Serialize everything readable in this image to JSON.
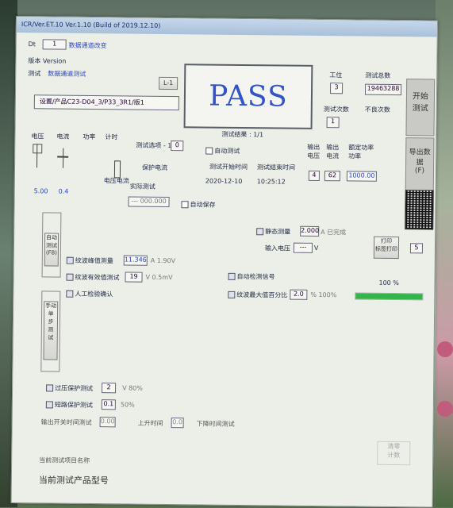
{
  "window": {
    "title": "ICR/Ver.ET.10 Ver.1.10 (Build of 2019.12.10)"
  },
  "left_panel": {
    "product_label": "Dt",
    "product_value": "1",
    "product_link": "数据通道改变",
    "device_label": "版本 Version",
    "pcs_label": "测试",
    "pcs_link": "数据通道测试",
    "side_btn": "L-1",
    "name_box": "设置/产品C23-D04_3/P33_3R1/版1"
  },
  "result": {
    "status": "PASS",
    "caption": "测试结果 : 1/1"
  },
  "right_top": {
    "station_label": "工位",
    "station_value": "3",
    "pass_label": "测试次数",
    "pass_value": "1",
    "total_label": "测试总数",
    "total_value": "19463288",
    "fail_label": "不良次数",
    "fail_value": "1",
    "start_btn": "开始\n测试",
    "export_btn": "导出数据\n(F)"
  },
  "middle_block": {
    "c1": "电压",
    "c2": "电流",
    "c3": "功率",
    "c4": "计时",
    "set_label": "测试选项 - 1",
    "set_value": "0",
    "limit_label": "保护电流",
    "result_label": "实际测试",
    "result_value": "--- 000.000",
    "voltage_unit": "电压",
    "current_unit": "电流",
    "reading_1": "5.00",
    "reading_2": "0.4",
    "auto_check": "自动测试",
    "date_label_1": "测试开始时间",
    "date_value_1": "2020-12-10",
    "date_label_2": "测试结束时间",
    "date_value_2": "10:25:12",
    "auto_save": "自动保存",
    "col_a": "输出\n电压",
    "col_b": "输出\n电流",
    "col_c": "额定功率\n功率",
    "col_d": "设定功率\n功率",
    "val_a": "4",
    "val_b": "62",
    "val_c": "1000.00"
  },
  "panel_rows": {
    "row1_label": "静态测量",
    "row1_value": "2.000",
    "row1_unit": "A 已完成",
    "row2_label": "输入电压",
    "row2_value": "---",
    "row2_unit": "V",
    "row3_label": "纹波峰值测量",
    "row3_value": "11.346",
    "row3_unit": "A 1.90V",
    "row4_label": "纹波有效值测试",
    "row4_value": "19",
    "row4_unit": "V 0.5mV",
    "row5_label": "人工检验确认",
    "row6_label": "自动检测信号",
    "row7_label": "纹波最大值百分比",
    "row7_value": "2.0",
    "row7_unit": "% 100%",
    "progress_label": "100 %",
    "progress": 1.0,
    "right_btn": "打印\n标签打印",
    "right_small": "5",
    "left_vbtn_1": "自动\n测试\n(F8)",
    "left_vbtn_2": "手动\n单\n步\n测\n试"
  },
  "bottom": {
    "b1_label": "过压保护测试",
    "b1_value": "2",
    "b1_unit": "V 80%",
    "b2_label": "短路保护测试",
    "b2_value": "0.1",
    "b2_unit": "50%",
    "b3": "输出开关时间测试",
    "b3_val": "0.00",
    "b4": "上升时间",
    "b4_val": "0.0",
    "b5": "下降时间测试",
    "footer_caption": "当前测试项目名称",
    "footer_text": "当前测试产品型号",
    "corner_btn": "清零\n计数"
  },
  "colors": {
    "pass_text": "#3254c8",
    "progress_fill": "#33b549",
    "link": "#2b46c4"
  }
}
